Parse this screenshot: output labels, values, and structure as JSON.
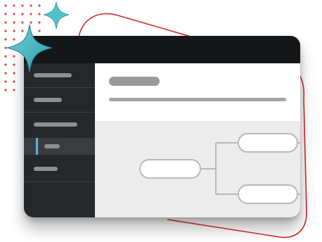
{
  "illustration": {
    "theme": {
      "window_bg": "#1f2225",
      "titlebar_bg": "#151617",
      "sidebar_bg": "#25282b",
      "content_bg": "#ececec",
      "header_bg": "#ffffff",
      "accent_indicator": "#5ab2dc",
      "decor_line_color": "#d42a2a",
      "dot_color": "#e04848",
      "sparkle_color": "#3fb8c2"
    },
    "sidebar": {
      "items": [
        {
          "name": "sidebar-item-1",
          "active": false
        },
        {
          "name": "sidebar-item-2",
          "active": false
        },
        {
          "name": "sidebar-item-3",
          "active": false
        },
        {
          "name": "sidebar-item-4",
          "active": true
        },
        {
          "name": "sidebar-item-5",
          "active": false
        }
      ]
    },
    "diagram": {
      "nodes": [
        "root-node",
        "top-child-node",
        "bottom-child-node"
      ]
    },
    "decorations": [
      "large-sparkle-icon",
      "small-sparkle-icon",
      "dot-grid",
      "red-outline-shape"
    ]
  }
}
